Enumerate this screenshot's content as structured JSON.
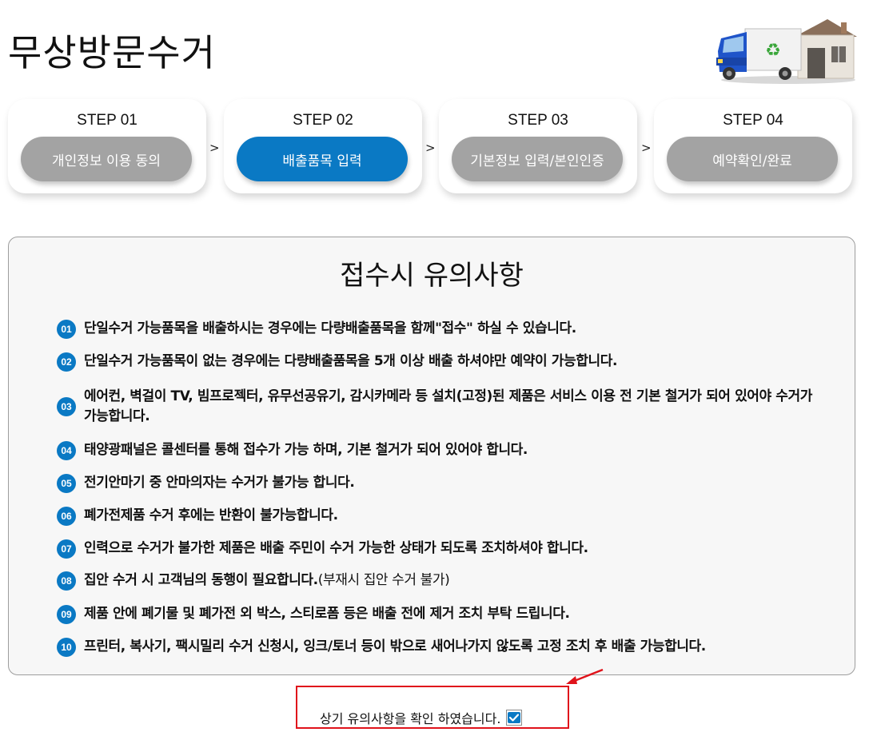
{
  "page": {
    "title": "무상방문수거"
  },
  "steps": [
    {
      "step": "STEP 01",
      "label": "개인정보 이용 동의",
      "active": false
    },
    {
      "step": "STEP 02",
      "label": "배출품목 입력",
      "active": true
    },
    {
      "step": "STEP 03",
      "label": "기본정보 입력/본인인증",
      "active": false
    },
    {
      "step": "STEP 04",
      "label": "예약확인/완료",
      "active": false
    }
  ],
  "step_separator": ">",
  "notice": {
    "title": "접수시 유의사항",
    "items": [
      {
        "num": "01",
        "text": "단일수거 가능품목을 배출하시는 경우에는 다량배출품목을 함께\"접수\" 하실 수 있습니다.",
        "note": ""
      },
      {
        "num": "02",
        "text": "단일수거 가능품목이 없는 경우에는 다량배출품목을 5개 이상 배출 하셔야만 예약이 가능합니다.",
        "note": ""
      },
      {
        "num": "03",
        "text": "에어컨, 벽걸이 TV, 빔프로젝터, 유무선공유기, 감시카메라 등 설치(고정)된 제품은 서비스 이용 전 기본 철거가 되어 있어야 수거가 가능합니다.",
        "note": ""
      },
      {
        "num": "04",
        "text": "태양광패널은 콜센터를 통해 접수가 가능 하며, 기본 철거가 되어 있어야 합니다.",
        "note": ""
      },
      {
        "num": "05",
        "text": "전기안마기 중 안마의자는 수거가 불가능 합니다.",
        "note": ""
      },
      {
        "num": "06",
        "text": "폐가전제품 수거 후에는 반환이 불가능합니다.",
        "note": ""
      },
      {
        "num": "07",
        "text": "인력으로 수거가 불가한 제품은 배출 주민이 수거 가능한 상태가 되도록 조치하셔야 합니다.",
        "note": ""
      },
      {
        "num": "08",
        "text": "집안 수거 시 고객님의 동행이 필요합니다.",
        "note": "(부재시 집안 수거 불가)"
      },
      {
        "num": "09",
        "text": "제품 안에 폐기물 및 폐가전 외 박스, 스티로폼 등은 배출 전에 제거 조치 부탁 드립니다.",
        "note": ""
      },
      {
        "num": "10",
        "text": "프린터, 복사기, 팩시밀리 수거 신청시, 잉크/토너 등이 밖으로 새어나가지 않도록 고정 조치 후 배출 가능합니다.",
        "note": ""
      }
    ]
  },
  "confirm": {
    "label": "상기 유의사항을 확인 하였습니다.",
    "checked": true
  },
  "colors": {
    "accent": "#0a79c4",
    "inactive_pill": "#a3a3a3",
    "highlight": "#e0131b"
  },
  "icons": {
    "header_image": "truck-house-illustration",
    "confirm_pointer": "red-arrow-icon",
    "checkbox_mark": "checkmark-icon"
  }
}
